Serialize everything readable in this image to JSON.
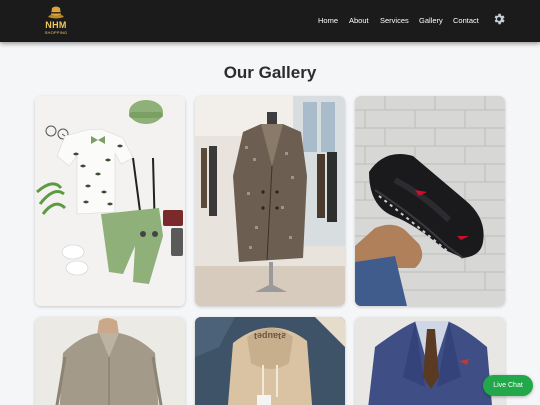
{
  "brand": {
    "name": "NHM",
    "tagline": "SHOPPING"
  },
  "nav": {
    "items": [
      {
        "label": "Home"
      },
      {
        "label": "About"
      },
      {
        "label": "Services"
      },
      {
        "label": "Gallery"
      },
      {
        "label": "Contact"
      }
    ],
    "settings_icon": "gear-icon"
  },
  "gallery": {
    "title": "Our Gallery",
    "items": [
      {
        "subject": "kids-outfit-flatlay"
      },
      {
        "subject": "houndstooth-overcoat-mannequin"
      },
      {
        "subject": "black-sneaker-in-hand"
      },
      {
        "subject": "grey-blazer-back"
      },
      {
        "subject": "beige-hoodie-flatlay"
      },
      {
        "subject": "navy-suit-brown-tie"
      }
    ]
  },
  "chat": {
    "label": "Live Chat"
  },
  "colors": {
    "navbar": "#1b1b1b",
    "brand": "#f3c85a",
    "chat": "#22a84a",
    "page_bg": "#f5f6f8"
  }
}
